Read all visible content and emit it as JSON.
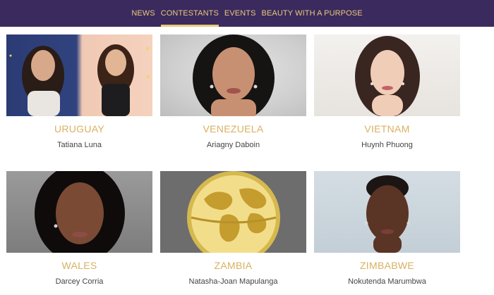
{
  "nav": {
    "items": [
      {
        "label": "NEWS",
        "active": false
      },
      {
        "label": "CONTESTANTS",
        "active": true
      },
      {
        "label": "EVENTS",
        "active": false
      },
      {
        "label": "BEAUTY WITH A PURPOSE",
        "active": false
      }
    ]
  },
  "contestants": [
    {
      "country": "URUGUAY",
      "name": "Tatiana Luna"
    },
    {
      "country": "VENEZUELA",
      "name": "Ariagny Daboin"
    },
    {
      "country": "VIETNAM",
      "name": "Huynh Phuong"
    },
    {
      "country": "WALES",
      "name": "Darcey Corria"
    },
    {
      "country": "ZAMBIA",
      "name": "Natasha-Joan Mapulanga"
    },
    {
      "country": "ZIMBABWE",
      "name": "Nokutenda Marumbwa"
    }
  ],
  "colors": {
    "nav_bg": "#3b2a5e",
    "accent_gold": "#d9b160",
    "nav_text": "#e8c97a"
  }
}
